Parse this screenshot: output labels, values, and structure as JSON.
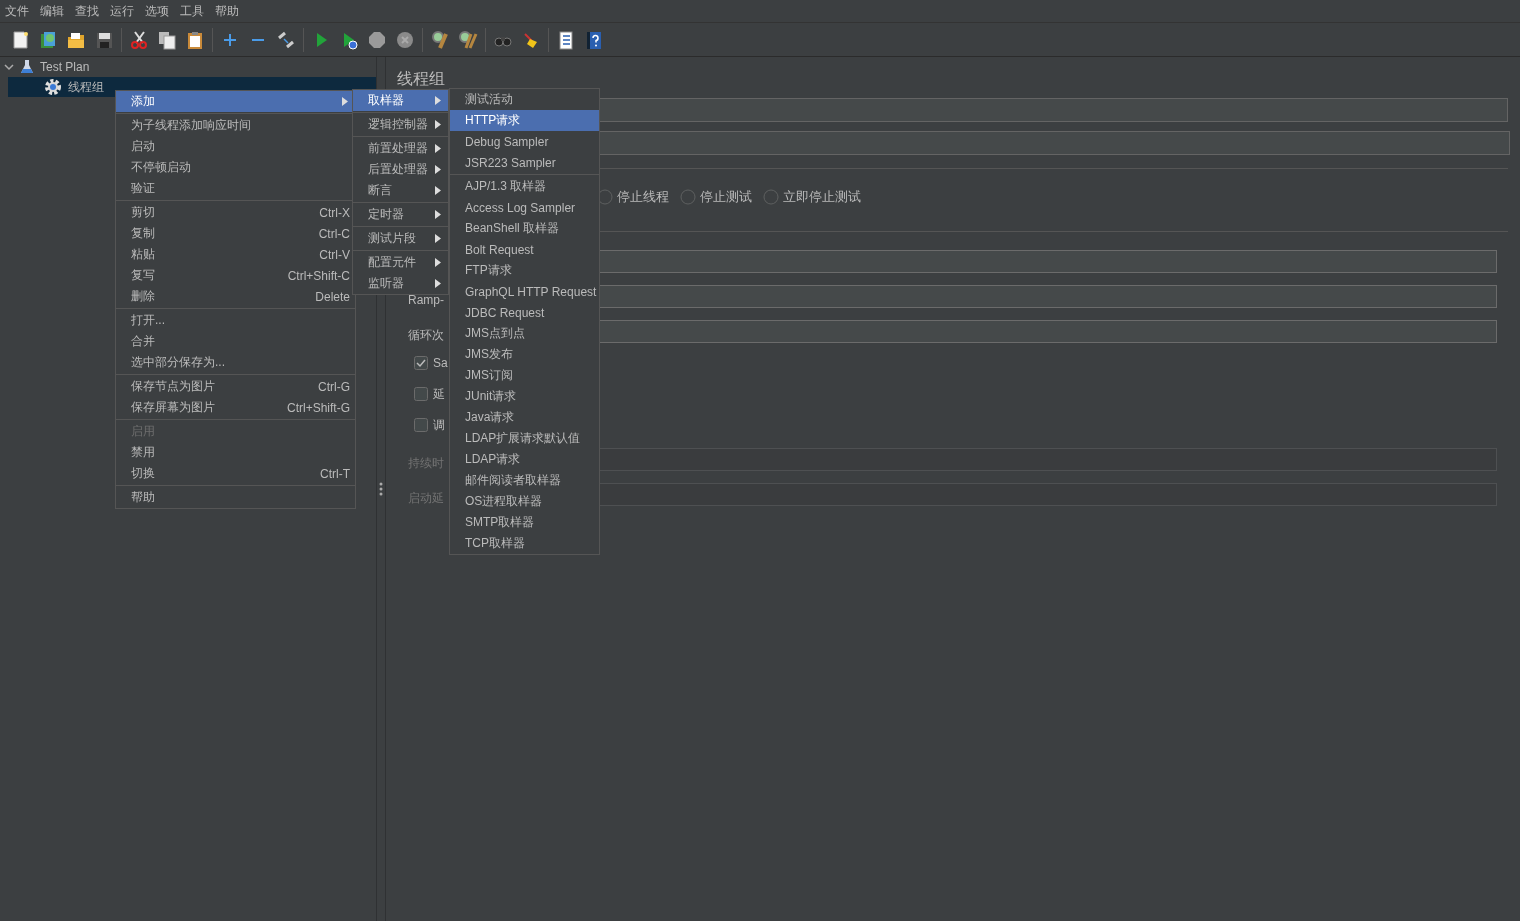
{
  "menu_bar": [
    "文件",
    "编辑",
    "查找",
    "运行",
    "选项",
    "工具",
    "帮助"
  ],
  "tree": [
    {
      "label": "Test Plan",
      "expanded": true,
      "selected": false,
      "children": [
        {
          "label": "线程组",
          "selected": true
        }
      ]
    }
  ],
  "panel": {
    "title": "线程组",
    "radio_options": [
      {
        "label": "停止线程",
        "selected": false
      },
      {
        "label": "停止测试",
        "selected": false
      },
      {
        "label": "立即停止测试",
        "selected": false
      }
    ],
    "rows": [
      {
        "kind": "field",
        "disabled": false
      },
      {
        "kind": "field",
        "label": "Ramp-",
        "disabled": false
      },
      {
        "kind": "field",
        "label": "循环次",
        "disabled": false
      },
      {
        "kind": "checkbox",
        "label": "Sa",
        "checked": true
      },
      {
        "kind": "checkbox",
        "label": "延",
        "checked": false
      },
      {
        "kind": "checkbox",
        "label": "调",
        "checked": false
      },
      {
        "kind": "field",
        "label": "持续时",
        "disabled": true
      },
      {
        "kind": "field",
        "label": "启动延",
        "disabled": true
      }
    ]
  },
  "context_menu": {
    "items": [
      {
        "kind": "item",
        "label": "添加",
        "selected": true,
        "submenu": true,
        "disabled": false
      },
      {
        "kind": "separator"
      },
      {
        "kind": "item",
        "label": "为子线程添加响应时间",
        "selected": false,
        "submenu": false,
        "disabled": false
      },
      {
        "kind": "item",
        "label": "启动",
        "selected": false,
        "submenu": false,
        "disabled": false
      },
      {
        "kind": "item",
        "label": "不停顿启动",
        "selected": false,
        "submenu": false,
        "disabled": false
      },
      {
        "kind": "item",
        "label": "验证",
        "selected": false,
        "submenu": false,
        "disabled": false
      },
      {
        "kind": "separator"
      },
      {
        "kind": "item",
        "label": "剪切",
        "shortcut": "Ctrl-X",
        "selected": false,
        "submenu": false,
        "disabled": false
      },
      {
        "kind": "item",
        "label": "复制",
        "shortcut": "Ctrl-C",
        "selected": false,
        "submenu": false,
        "disabled": false
      },
      {
        "kind": "item",
        "label": "粘贴",
        "shortcut": "Ctrl-V",
        "selected": false,
        "submenu": false,
        "disabled": false
      },
      {
        "kind": "item",
        "label": "复写",
        "shortcut": "Ctrl+Shift-C",
        "selected": false,
        "submenu": false,
        "disabled": false
      },
      {
        "kind": "item",
        "label": "删除",
        "shortcut": "Delete",
        "selected": false,
        "submenu": false,
        "disabled": false
      },
      {
        "kind": "separator"
      },
      {
        "kind": "item",
        "label": "打开...",
        "selected": false,
        "submenu": false,
        "disabled": false
      },
      {
        "kind": "item",
        "label": "合并",
        "selected": false,
        "submenu": false,
        "disabled": false
      },
      {
        "kind": "item",
        "label": "选中部分保存为...",
        "selected": false,
        "submenu": false,
        "disabled": false
      },
      {
        "kind": "separator"
      },
      {
        "kind": "item",
        "label": "保存节点为图片",
        "shortcut": "Ctrl-G",
        "selected": false,
        "submenu": false,
        "disabled": false
      },
      {
        "kind": "item",
        "label": "保存屏幕为图片",
        "shortcut": "Ctrl+Shift-G",
        "selected": false,
        "submenu": false,
        "disabled": false
      },
      {
        "kind": "separator"
      },
      {
        "kind": "item",
        "label": "启用",
        "selected": false,
        "submenu": false,
        "disabled": true
      },
      {
        "kind": "item",
        "label": "禁用",
        "selected": false,
        "submenu": false,
        "disabled": false
      },
      {
        "kind": "item",
        "label": "切换",
        "shortcut": "Ctrl-T",
        "selected": false,
        "submenu": false,
        "disabled": false
      },
      {
        "kind": "separator"
      },
      {
        "kind": "item",
        "label": "帮助",
        "selected": false,
        "submenu": false,
        "disabled": false
      }
    ]
  },
  "add_submenu": {
    "items": [
      {
        "kind": "item",
        "label": "取样器",
        "selected": true,
        "submenu": true
      },
      {
        "kind": "separator"
      },
      {
        "kind": "item",
        "label": "逻辑控制器",
        "selected": false,
        "submenu": true
      },
      {
        "kind": "separator"
      },
      {
        "kind": "item",
        "label": "前置处理器",
        "selected": false,
        "submenu": true
      },
      {
        "kind": "item",
        "label": "后置处理器",
        "selected": false,
        "submenu": true
      },
      {
        "kind": "item",
        "label": "断言",
        "selected": false,
        "submenu": true
      },
      {
        "kind": "separator"
      },
      {
        "kind": "item",
        "label": "定时器",
        "selected": false,
        "submenu": true
      },
      {
        "kind": "separator"
      },
      {
        "kind": "item",
        "label": "测试片段",
        "selected": false,
        "submenu": true
      },
      {
        "kind": "separator"
      },
      {
        "kind": "item",
        "label": "配置元件",
        "selected": false,
        "submenu": true
      },
      {
        "kind": "item",
        "label": "监听器",
        "selected": false,
        "submenu": true
      }
    ]
  },
  "sampler_submenu": {
    "items": [
      {
        "kind": "item",
        "label": "测试活动",
        "selected": false
      },
      {
        "kind": "item",
        "label": "HTTP请求",
        "selected": true
      },
      {
        "kind": "item",
        "label": "Debug Sampler",
        "selected": false
      },
      {
        "kind": "item",
        "label": "JSR223 Sampler",
        "selected": false
      },
      {
        "kind": "separator"
      },
      {
        "kind": "item",
        "label": "AJP/1.3 取样器",
        "selected": false
      },
      {
        "kind": "item",
        "label": "Access Log Sampler",
        "selected": false
      },
      {
        "kind": "item",
        "label": "BeanShell 取样器",
        "selected": false
      },
      {
        "kind": "item",
        "label": "Bolt Request",
        "selected": false
      },
      {
        "kind": "item",
        "label": "FTP请求",
        "selected": false
      },
      {
        "kind": "item",
        "label": "GraphQL HTTP Request",
        "selected": false
      },
      {
        "kind": "item",
        "label": "JDBC Request",
        "selected": false
      },
      {
        "kind": "item",
        "label": "JMS点到点",
        "selected": false
      },
      {
        "kind": "item",
        "label": "JMS发布",
        "selected": false
      },
      {
        "kind": "item",
        "label": "JMS订阅",
        "selected": false
      },
      {
        "kind": "item",
        "label": "JUnit请求",
        "selected": false
      },
      {
        "kind": "item",
        "label": "Java请求",
        "selected": false
      },
      {
        "kind": "item",
        "label": "LDAP扩展请求默认值",
        "selected": false
      },
      {
        "kind": "item",
        "label": "LDAP请求",
        "selected": false
      },
      {
        "kind": "item",
        "label": "邮件阅读者取样器",
        "selected": false
      },
      {
        "kind": "item",
        "label": "OS进程取样器",
        "selected": false
      },
      {
        "kind": "item",
        "label": "SMTP取样器",
        "selected": false
      },
      {
        "kind": "item",
        "label": "TCP取样器",
        "selected": false
      }
    ]
  }
}
